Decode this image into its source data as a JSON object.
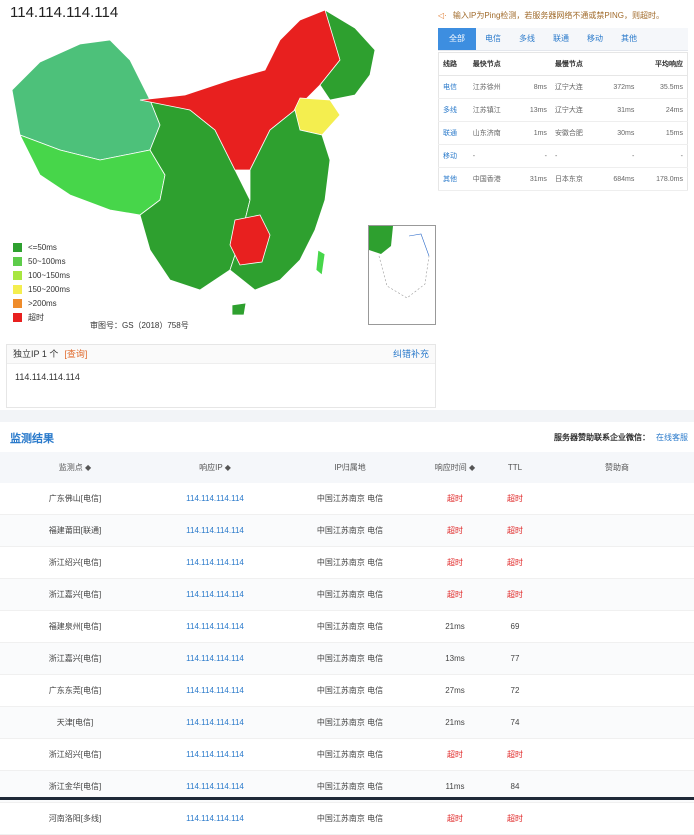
{
  "ip": "114.114.114.114",
  "map": {
    "legend": [
      {
        "label": "<=50ms",
        "color": "#2ea02f"
      },
      {
        "label": "50~100ms",
        "color": "#5dcc4a"
      },
      {
        "label": "100~150ms",
        "color": "#a8e640"
      },
      {
        "label": "150~200ms",
        "color": "#f4ee4f"
      },
      {
        "label": ">200ms",
        "color": "#ef8c2b"
      },
      {
        "label": "超时",
        "color": "#e8201f"
      }
    ],
    "approval_no": "审图号：GS（2018）758号",
    "region_colors": {
      "xinjiang": "#4dc17a",
      "tibet": "#47d64a",
      "qinghai": "#2ea02f",
      "timeout": "#e8201f",
      "liaoning": "#f4ee4f",
      "default": "#2ea02f"
    }
  },
  "ip_box": {
    "label": "独立IP 1 个",
    "query": "[查询]",
    "fix": "纠错补充",
    "ips": "114.114.114.114"
  },
  "hint": "输入IP为Ping检测，若服务器网络不通或禁PING，则超时。",
  "tabs": [
    "全部",
    "电信",
    "多线",
    "联通",
    "移动",
    "其他"
  ],
  "isp_table": {
    "headers": [
      "线路",
      "最快节点",
      "",
      "最慢节点",
      "",
      "平均响应"
    ],
    "rows": [
      [
        "电信",
        "江苏徐州",
        "8ms",
        "辽宁大连",
        "372ms",
        "35.5ms"
      ],
      [
        "多线",
        "江苏镇江",
        "13ms",
        "辽宁大连",
        "31ms",
        "24ms"
      ],
      [
        "联通",
        "山东济南",
        "1ms",
        "安徽合肥",
        "30ms",
        "15ms"
      ],
      [
        "移动",
        "-",
        "-",
        "-",
        "-",
        "-"
      ],
      [
        "其他",
        "中国香港",
        "31ms",
        "日本东京",
        "684ms",
        "178.0ms"
      ]
    ]
  },
  "results": {
    "title": "监测结果",
    "sponsor_label": "服务器赞助联系企业微信：",
    "sponsor_link": "在线客服",
    "headers": [
      "监测点",
      "响应IP",
      "IP归属地",
      "响应时间",
      "TTL",
      "赞助商"
    ],
    "rows": [
      [
        "广东佛山[电信]",
        "114.114.114.114",
        "中国江苏南京 电信",
        "超时",
        "超时",
        ""
      ],
      [
        "福建莆田[联通]",
        "114.114.114.114",
        "中国江苏南京 电信",
        "超时",
        "超时",
        ""
      ],
      [
        "浙江绍兴[电信]",
        "114.114.114.114",
        "中国江苏南京 电信",
        "超时",
        "超时",
        ""
      ],
      [
        "浙江嘉兴[电信]",
        "114.114.114.114",
        "中国江苏南京 电信",
        "超时",
        "超时",
        ""
      ],
      [
        "福建泉州[电信]",
        "114.114.114.114",
        "中国江苏南京 电信",
        "21ms",
        "69",
        ""
      ],
      [
        "浙江嘉兴[电信]",
        "114.114.114.114",
        "中国江苏南京 电信",
        "13ms",
        "77",
        ""
      ],
      [
        "广东东莞[电信]",
        "114.114.114.114",
        "中国江苏南京 电信",
        "27ms",
        "72",
        ""
      ],
      [
        "天津[电信]",
        "114.114.114.114",
        "中国江苏南京 电信",
        "21ms",
        "74",
        ""
      ],
      [
        "浙江绍兴[电信]",
        "114.114.114.114",
        "中国江苏南京 电信",
        "超时",
        "超时",
        ""
      ],
      [
        "浙江金华[电信]",
        "114.114.114.114",
        "中国江苏南京 电信",
        "11ms",
        "84",
        ""
      ],
      [
        "河南洛阳[多线]",
        "114.114.114.114",
        "中国江苏南京 电信",
        "超时",
        "超时",
        ""
      ]
    ]
  }
}
